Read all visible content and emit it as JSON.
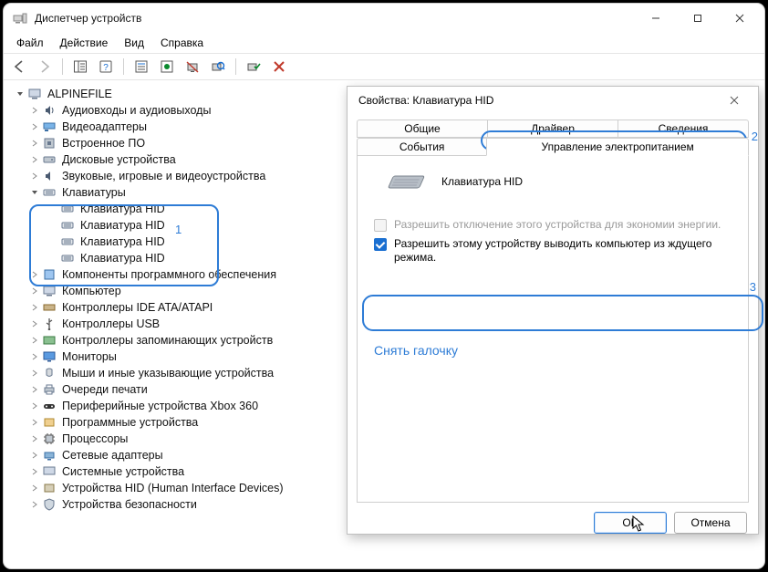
{
  "window": {
    "title": "Диспетчер устройств"
  },
  "menu": {
    "file": "Файл",
    "action": "Действие",
    "view": "Вид",
    "help": "Справка"
  },
  "annotations": {
    "n1": "1",
    "n2": "2",
    "n3": "3",
    "remove_check": "Снять галочку"
  },
  "tree": {
    "root": "ALPINEFILE",
    "items": [
      "Аудиовходы и аудиовыходы",
      "Видеоадаптеры",
      "Встроенное ПО",
      "Дисковые устройства",
      "Звуковые, игровые и видеоустройства"
    ],
    "kb_category": "Клавиатуры",
    "kb_items": [
      "Клавиатура HID",
      "Клавиатура HID",
      "Клавиатура HID",
      "Клавиатура HID"
    ],
    "items2": [
      "Компоненты программного обеспечения",
      "Компьютер",
      "Контроллеры IDE ATA/ATAPI",
      "Контроллеры USB",
      "Контроллеры запоминающих устройств",
      "Мониторы",
      "Мыши и иные указывающие устройства",
      "Очереди печати",
      "Периферийные устройства Xbox 360",
      "Программные устройства",
      "Процессоры",
      "Сетевые адаптеры",
      "Системные устройства",
      "Устройства HID (Human Interface Devices)",
      "Устройства безопасности"
    ]
  },
  "dialog": {
    "title": "Свойства: Клавиатура HID",
    "tabs": {
      "general": "Общие",
      "driver": "Драйвер",
      "details": "Сведения",
      "events": "События",
      "power": "Управление электропитанием"
    },
    "device_name": "Клавиатура HID",
    "chk_power_off": "Разрешить отключение этого устройства для экономии энергии.",
    "chk_wake": "Разрешить этому устройству выводить компьютер из ждущего режима.",
    "ok": "OK",
    "cancel": "Отмена"
  }
}
